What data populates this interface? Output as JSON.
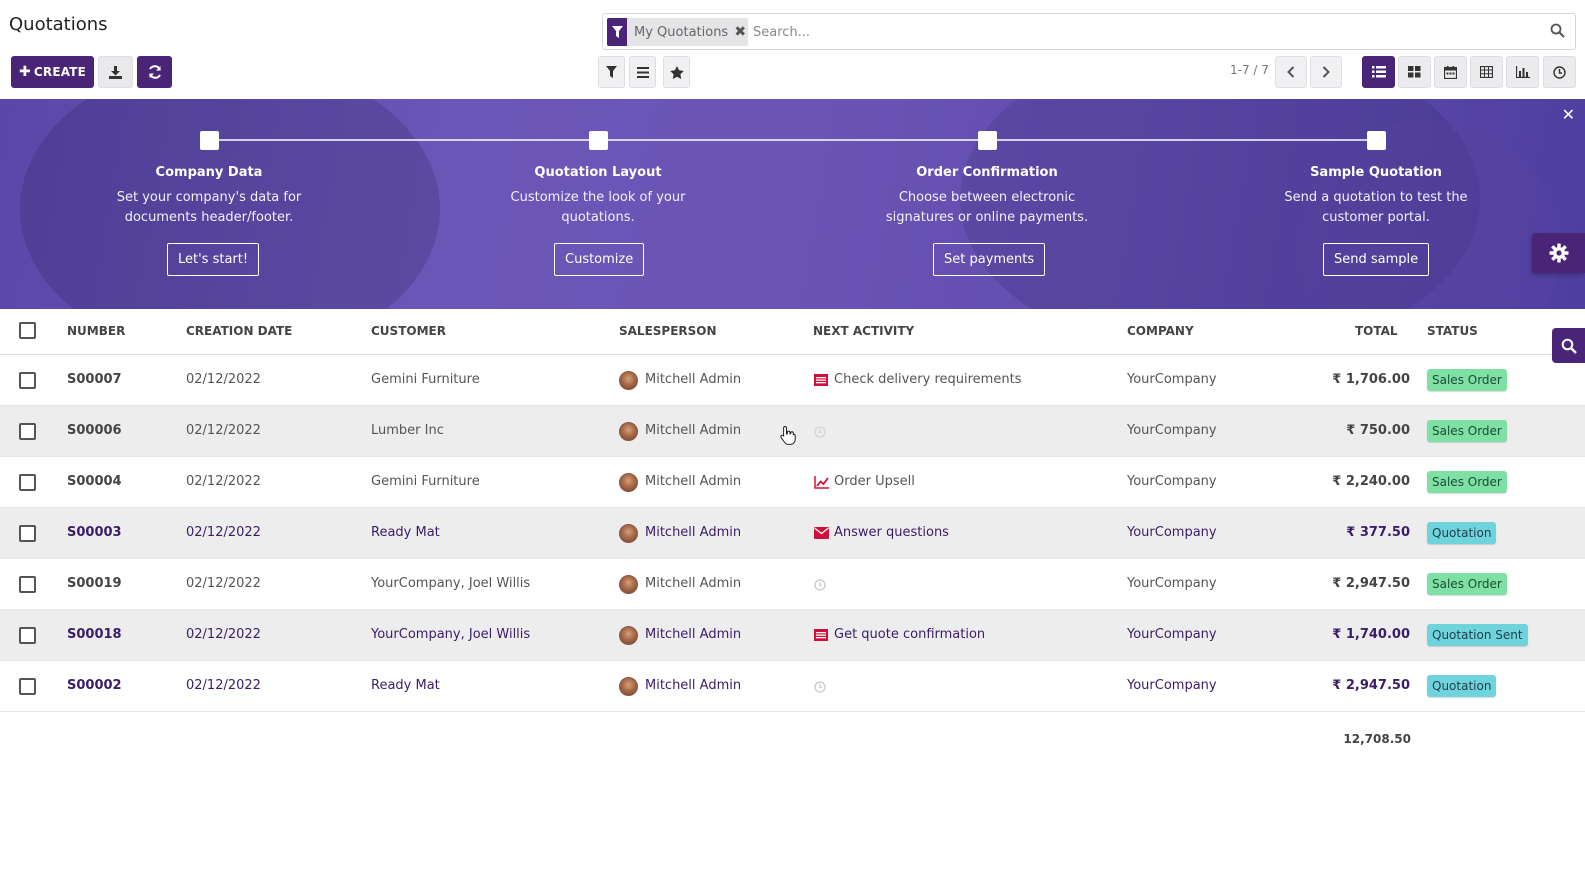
{
  "page": {
    "title": "Quotations"
  },
  "toolbar": {
    "create_label": "CREATE"
  },
  "search": {
    "facet_label": "My Quotations",
    "placeholder": "Search..."
  },
  "pager": {
    "text": "1-7 / 7"
  },
  "banner": {
    "steps": [
      {
        "title": "Company Data",
        "desc_line1": "Set your company's data for",
        "desc_line2": "documents header/footer.",
        "button": "Let's start!"
      },
      {
        "title": "Quotation Layout",
        "desc_line1": "Customize the look of your",
        "desc_line2": "quotations.",
        "button": "Customize"
      },
      {
        "title": "Order Confirmation",
        "desc_line1": "Choose between electronic",
        "desc_line2": "signatures or online payments.",
        "button": "Set payments"
      },
      {
        "title": "Sample Quotation",
        "desc_line1": "Send a quotation to test the",
        "desc_line2": "customer portal.",
        "button": "Send sample"
      }
    ]
  },
  "table": {
    "columns": {
      "number": "NUMBER",
      "creation_date": "CREATION DATE",
      "customer": "CUSTOMER",
      "salesperson": "SALESPERSON",
      "next_activity": "NEXT ACTIVITY",
      "company": "COMPANY",
      "total": "TOTAL",
      "status": "STATUS"
    },
    "rows": [
      {
        "number": "S00007",
        "date": "02/12/2022",
        "customer": "Gemini Furniture",
        "salesperson": "Mitchell Admin",
        "activity": "Check delivery requirements",
        "activity_icon": "calendar-list-icon",
        "company": "YourCompany",
        "total": "₹ 1,706.00",
        "status": "Sales Order"
      },
      {
        "number": "S00006",
        "date": "02/12/2022",
        "customer": "Lumber Inc",
        "salesperson": "Mitchell Admin",
        "activity": "",
        "activity_icon": "clock-icon",
        "company": "YourCompany",
        "total": "₹ 750.00",
        "status": "Sales Order"
      },
      {
        "number": "S00004",
        "date": "02/12/2022",
        "customer": "Gemini Furniture",
        "salesperson": "Mitchell Admin",
        "activity": "Order Upsell",
        "activity_icon": "chart-line-icon",
        "company": "YourCompany",
        "total": "₹ 2,240.00",
        "status": "Sales Order"
      },
      {
        "number": "S00003",
        "date": "02/12/2022",
        "customer": "Ready Mat",
        "salesperson": "Mitchell Admin",
        "activity": "Answer questions",
        "activity_icon": "envelope-icon",
        "company": "YourCompany",
        "total": "₹ 377.50",
        "status": "Quotation"
      },
      {
        "number": "S00019",
        "date": "02/12/2022",
        "customer": "YourCompany, Joel Willis",
        "salesperson": "Mitchell Admin",
        "activity": "",
        "activity_icon": "clock-icon",
        "company": "YourCompany",
        "total": "₹ 2,947.50",
        "status": "Sales Order"
      },
      {
        "number": "S00018",
        "date": "02/12/2022",
        "customer": "YourCompany, Joel Willis",
        "salesperson": "Mitchell Admin",
        "activity": "Get quote confirmation",
        "activity_icon": "calendar-list-icon",
        "company": "YourCompany",
        "total": "₹ 1,740.00",
        "status": "Quotation Sent"
      },
      {
        "number": "S00002",
        "date": "02/12/2022",
        "customer": "Ready Mat",
        "salesperson": "Mitchell Admin",
        "activity": "",
        "activity_icon": "clock-icon",
        "company": "YourCompany",
        "total": "₹ 2,947.50",
        "status": "Quotation"
      }
    ],
    "grand_total": "12,708.50"
  },
  "colors": {
    "brand": "#4a2577",
    "banner": "#6a54b4",
    "badge_sales_order": "#7fe0a4",
    "badge_quotation": "#6fd3dc",
    "activity_red": "#d0103a"
  }
}
